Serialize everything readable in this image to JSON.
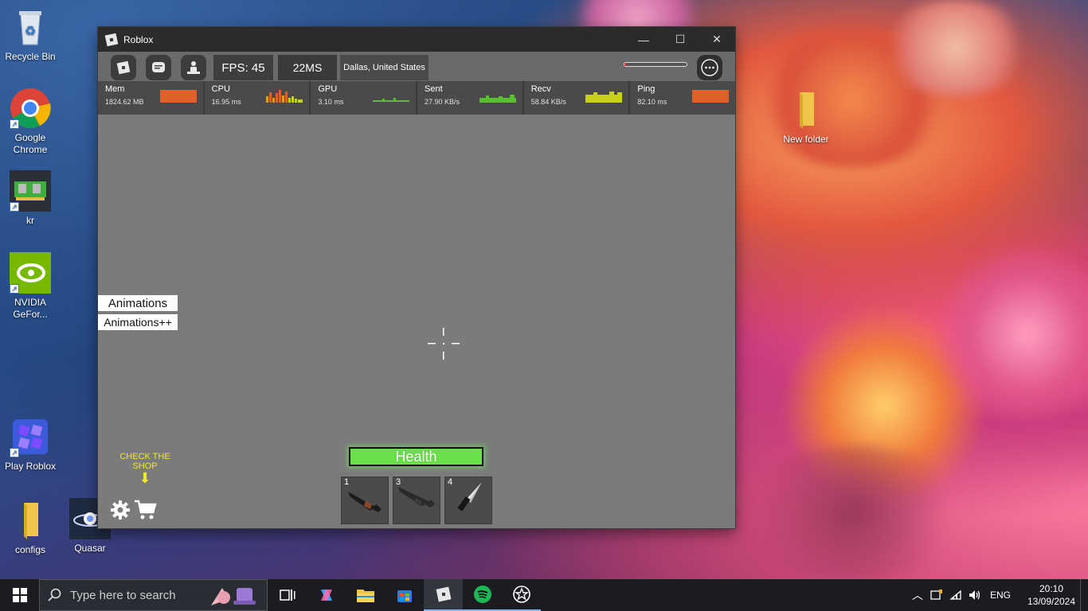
{
  "desktop": {
    "icons": [
      {
        "label": "Recycle Bin"
      },
      {
        "label": "Google Chrome"
      },
      {
        "label": "kr"
      },
      {
        "label": "NVIDIA GeFor..."
      },
      {
        "label": "Play Roblox"
      },
      {
        "label": "configs"
      },
      {
        "label": "Quasar"
      },
      {
        "label": "New folder"
      }
    ]
  },
  "window": {
    "title": "Roblox",
    "controls": {
      "minimize": "—",
      "maximize": "☐",
      "close": "✕"
    }
  },
  "topbar": {
    "fps": "FPS: 45",
    "latency": "22MS",
    "location": "Dallas, United States"
  },
  "stats": [
    {
      "name": "Mem",
      "value": "1824.62 MB",
      "color": "#e0602a"
    },
    {
      "name": "CPU",
      "value": "16.95 ms",
      "color": "#d6a11c"
    },
    {
      "name": "GPU",
      "value": "3.10 ms",
      "color": "#56c030"
    },
    {
      "name": "Sent",
      "value": "27.90 KB/s",
      "color": "#56c030"
    },
    {
      "name": "Recv",
      "value": "58.84 KB/s",
      "color": "#c8d21c"
    },
    {
      "name": "Ping",
      "value": "82.10 ms",
      "color": "#e0602a"
    }
  ],
  "side_buttons": {
    "animations": "Animations",
    "animations_plus": "Animations++"
  },
  "hud": {
    "health_label": "Health",
    "health_color": "#6be04a",
    "shop_hint": "CHECK THE SHOP",
    "slots": [
      {
        "number": "1",
        "item": "shotgun-icon"
      },
      {
        "number": "3",
        "item": "shotgun-icon"
      },
      {
        "number": "4",
        "item": "knife-icon"
      }
    ]
  },
  "taskbar": {
    "search_placeholder": "Type here to search",
    "language": "ENG",
    "time": "20:10",
    "date": "13/09/2024"
  }
}
